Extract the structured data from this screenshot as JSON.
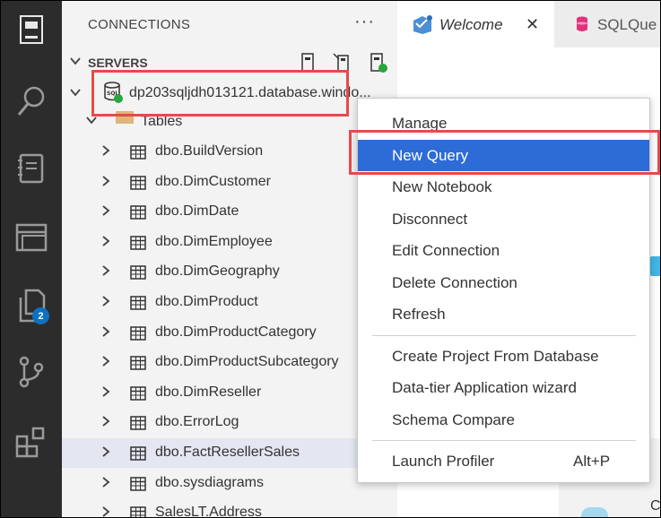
{
  "sidebar": {
    "title": "CONNECTIONS",
    "more": "···",
    "section_title": "SERVERS"
  },
  "server": {
    "name": "dp203sqljdh013121.database.windo..."
  },
  "tree": {
    "folder_label": "Tables",
    "tables": [
      "dbo.BuildVersion",
      "dbo.DimCustomer",
      "dbo.DimDate",
      "dbo.DimEmployee",
      "dbo.DimGeography",
      "dbo.DimProduct",
      "dbo.DimProductCategory",
      "dbo.DimProductSubcategory",
      "dbo.DimReseller",
      "dbo.ErrorLog",
      "dbo.FactResellerSales",
      "dbo.sysdiagrams",
      "SalesLT.Address"
    ],
    "selected": "dbo.FactResellerSales"
  },
  "activity_bar": {
    "icons": [
      "servers-icon",
      "search-icon",
      "notebook-icon",
      "dashboard-icon",
      "explorer-icon",
      "source-control-icon",
      "extensions-icon"
    ],
    "explorer_badge": "2"
  },
  "tabs": [
    {
      "label": "Welcome",
      "close": "✕"
    },
    {
      "label": "SQLQue"
    }
  ],
  "context_menu": {
    "groups": [
      [
        {
          "label": "Manage"
        },
        {
          "label": "New Query",
          "active": true
        },
        {
          "label": "New Notebook"
        },
        {
          "label": "Disconnect"
        },
        {
          "label": "Edit Connection"
        },
        {
          "label": "Delete Connection"
        },
        {
          "label": "Refresh"
        }
      ],
      [
        {
          "label": "Create Project From Database"
        },
        {
          "label": "Data-tier Application wizard"
        },
        {
          "label": "Schema Compare"
        }
      ],
      [
        {
          "label": "Launch Profiler",
          "shortcut": "Alt+P"
        }
      ]
    ]
  },
  "welcome_partial": {
    "letter": "C"
  },
  "colors": {
    "activity_bar": "#2c2c2c",
    "sidebar": "#f3f3f3",
    "menu_active": "#2d6bd6",
    "highlight": "#e74a4a",
    "badge": "#0e70c0",
    "connected": "#26a83a"
  }
}
